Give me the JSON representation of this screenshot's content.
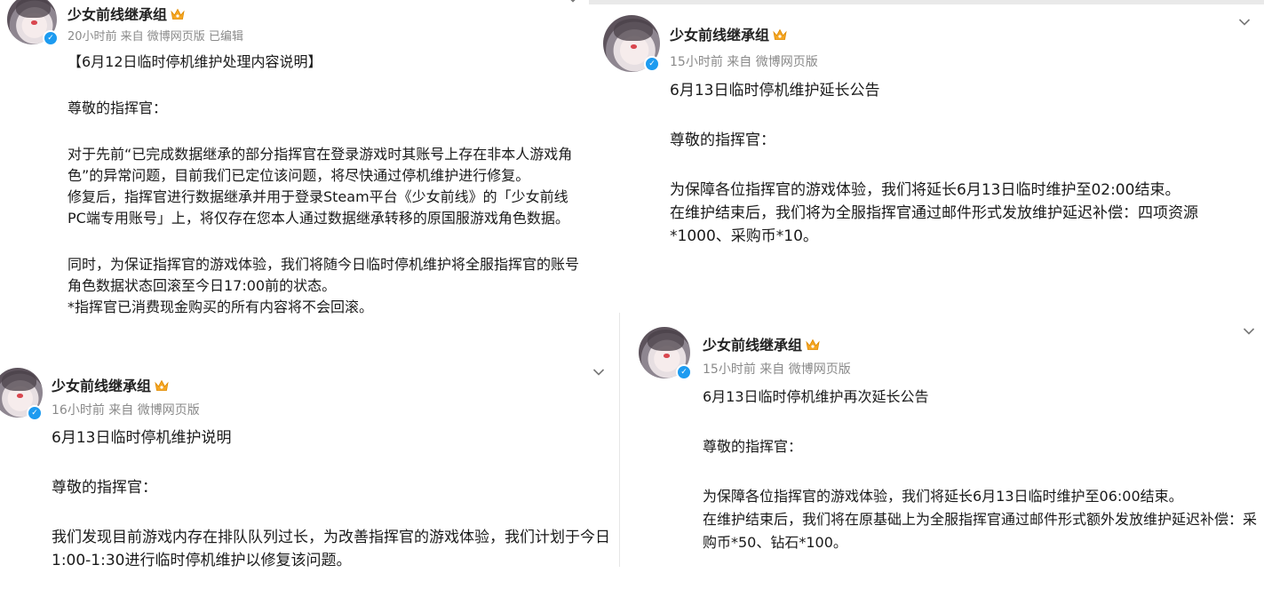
{
  "posts": [
    {
      "author": "少女前线继承组",
      "meta": "20小时前 来自 微博网页版 已编辑",
      "paragraphs": [
        [
          "【6月12日临时停机维护处理内容说明】"
        ],
        [
          "尊敬的指挥官："
        ],
        [
          "对于先前“已完成数据继承的部分指挥官在登录游戏时其账号上存在非本人游戏角色”的异常问题，目前我们已定位该问题，将尽快通过停机维护进行修复。",
          "修复后，指挥官进行数据继承并用于登录Steam平台《少女前线》的「少女前线PC端专用账号」上，将仅存在您本人通过数据继承转移的原国服游戏角色数据。"
        ],
        [
          "同时，为保证指挥官的游戏体验，我们将随今日临时停机维护将全服指挥官的账号角色数据状态回滚至今日17:00前的状态。",
          "*指挥官已消费现金购买的所有内容将不会回滚。"
        ]
      ]
    },
    {
      "author": "少女前线继承组",
      "meta": "15小时前 来自 微博网页版",
      "paragraphs": [
        [
          "6月13日临时停机维护延长公告"
        ],
        [
          "尊敬的指挥官："
        ],
        [
          "为保障各位指挥官的游戏体验，我们将延长6月13日临时维护至02:00结束。",
          "在维护结束后，我们将为全服指挥官通过邮件形式发放维护延迟补偿：四项资源*1000、采购币*10。"
        ]
      ]
    },
    {
      "author": "少女前线继承组",
      "meta": "16小时前 来自 微博网页版",
      "paragraphs": [
        [
          "6月13日临时停机维护说明"
        ],
        [
          "尊敬的指挥官："
        ],
        [
          "我们发现目前游戏内存在排队队列过长，为改善指挥官的游戏体验，我们计划于今日1:00-1:30进行临时停机维护以修复该问题。"
        ]
      ]
    },
    {
      "author": "少女前线继承组",
      "meta": "15小时前 来自 微博网页版",
      "paragraphs": [
        [
          "6月13日临时停机维护再次延长公告"
        ],
        [
          "尊敬的指挥官："
        ],
        [
          "为保障各位指挥官的游戏体验，我们将延长6月13日临时维护至06:00结束。",
          "在维护结束后，我们将在原基础上为全服指挥官通过邮件形式额外发放维护延迟补偿：采购币*50、钻石*100。"
        ]
      ]
    }
  ],
  "icons": {
    "verified": "verified-badge-icon",
    "crown": "vip-crown-icon",
    "more": "chevron-down-icon"
  },
  "colors": {
    "verified": "#1d9bf0",
    "crown": "#f5a623",
    "meta": "#8a8a8a"
  }
}
